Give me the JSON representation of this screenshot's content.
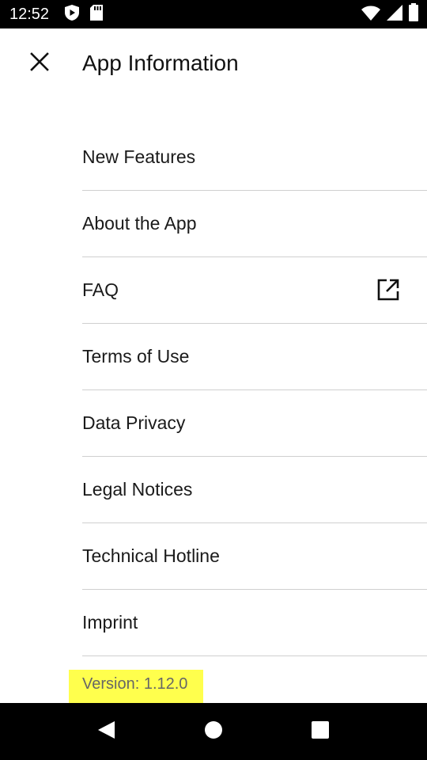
{
  "status_bar": {
    "time": "12:52",
    "left_icons": [
      "play-shield-icon",
      "sd-card-icon"
    ],
    "right_icons": [
      "wifi-icon",
      "signal-icon",
      "battery-icon"
    ]
  },
  "header": {
    "title": "App Information",
    "close_icon": "close-icon"
  },
  "menu": {
    "items": [
      {
        "label": "New Features",
        "icon": ""
      },
      {
        "label": "About the App",
        "icon": ""
      },
      {
        "label": "FAQ",
        "icon": "open-external-icon"
      },
      {
        "label": "Terms of Use",
        "icon": ""
      },
      {
        "label": "Data Privacy",
        "icon": ""
      },
      {
        "label": "Legal Notices",
        "icon": ""
      },
      {
        "label": "Technical Hotline",
        "icon": ""
      },
      {
        "label": "Imprint",
        "icon": ""
      }
    ]
  },
  "version": {
    "text": "Version: 1.12.0",
    "highlight_color": "#ffff4d"
  },
  "nav_bar": {
    "buttons": [
      "back-icon",
      "home-icon",
      "recents-icon"
    ]
  }
}
